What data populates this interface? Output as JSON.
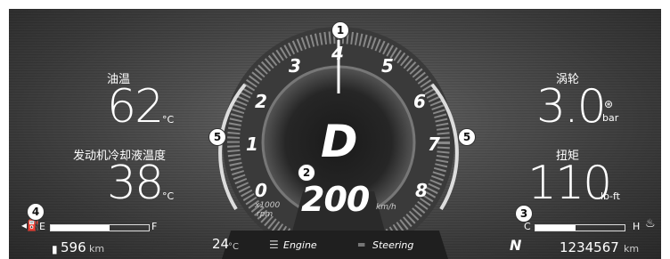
{
  "left": {
    "oil_temp_label": "油温",
    "oil_temp_value": "62",
    "oil_temp_unit": "°C",
    "coolant_label": "发动机冷却液温度",
    "coolant_value": "38",
    "coolant_unit": "°C",
    "fuel_empty": "E",
    "fuel_full": "F",
    "range_value": "596",
    "range_unit": "km"
  },
  "right": {
    "turbo_label": "涡轮",
    "turbo_value": "3.0",
    "turbo_unit": "bar",
    "torque_label": "扭矩",
    "torque_value": "110",
    "torque_unit": "lb-ft",
    "temp_cold": "C",
    "temp_hot": "H",
    "odometer_value": "1234567",
    "odometer_unit": "km"
  },
  "center": {
    "gear": "D",
    "speed": "200",
    "speed_unit": "km/h",
    "rpm_unit_line1": "x1000",
    "rpm_unit_line2": "rpm",
    "rpm_ticks": [
      "0",
      "1",
      "2",
      "3",
      "4",
      "5",
      "6",
      "7",
      "8"
    ]
  },
  "bottom": {
    "outside_temp": "24",
    "outside_temp_unit": "°C",
    "mode1": "Engine",
    "mode2": "Steering",
    "logo": "N"
  },
  "callouts": [
    "1",
    "2",
    "3",
    "4",
    "5",
    "5"
  ]
}
